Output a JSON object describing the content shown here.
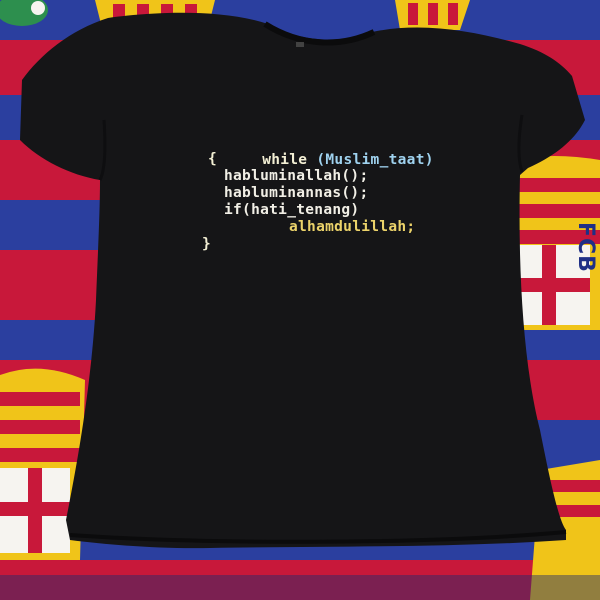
{
  "shirt_print": {
    "line1_keyword": "while",
    "line1_condition": "(Muslim_taat)",
    "line2": "{",
    "line3": "habluminallah();",
    "line4": "habluminannas();",
    "line5": "if(hati_tenang)",
    "line6": "alhamdulillah;",
    "line7": "}"
  },
  "blanket_crest_text": "FCB",
  "colors": {
    "shirt": "#141416",
    "blanket_blue": "#2a3f9e",
    "blanket_red": "#c8183a",
    "crest_yellow": "#f0c419",
    "code_keyword": "#f3efd4",
    "code_identifier": "#9fd2ef",
    "code_highlight": "#ecd36a"
  }
}
